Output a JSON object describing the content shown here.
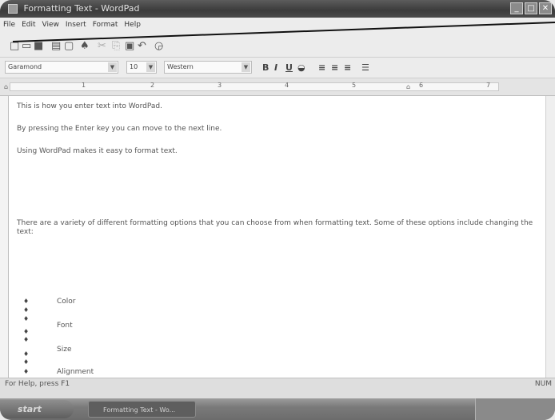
{
  "window": {
    "title": "Formatting Text - WordPad"
  },
  "menu": [
    "File",
    "Edit",
    "View",
    "Insert",
    "Format",
    "Help"
  ],
  "format_bar": {
    "font": "Garamond",
    "size": "10",
    "script": "Western"
  },
  "document": {
    "lines": [
      "This is how you enter text into WordPad.",
      "By pressing the Enter key you can move to the next line.",
      "Using WordPad makes it easy to format text."
    ],
    "paragraph": "There are a variety of different formatting options that you can choose from when formatting text.  Some of these options include changing the text:",
    "bullets": [
      "Color",
      "Font",
      "Size",
      "Alignment"
    ]
  },
  "statusbar": {
    "help": "For Help, press F1",
    "mode": "NUM"
  },
  "taskbar": {
    "start_label": "start",
    "task_label": "Formatting Text - Wo..."
  }
}
